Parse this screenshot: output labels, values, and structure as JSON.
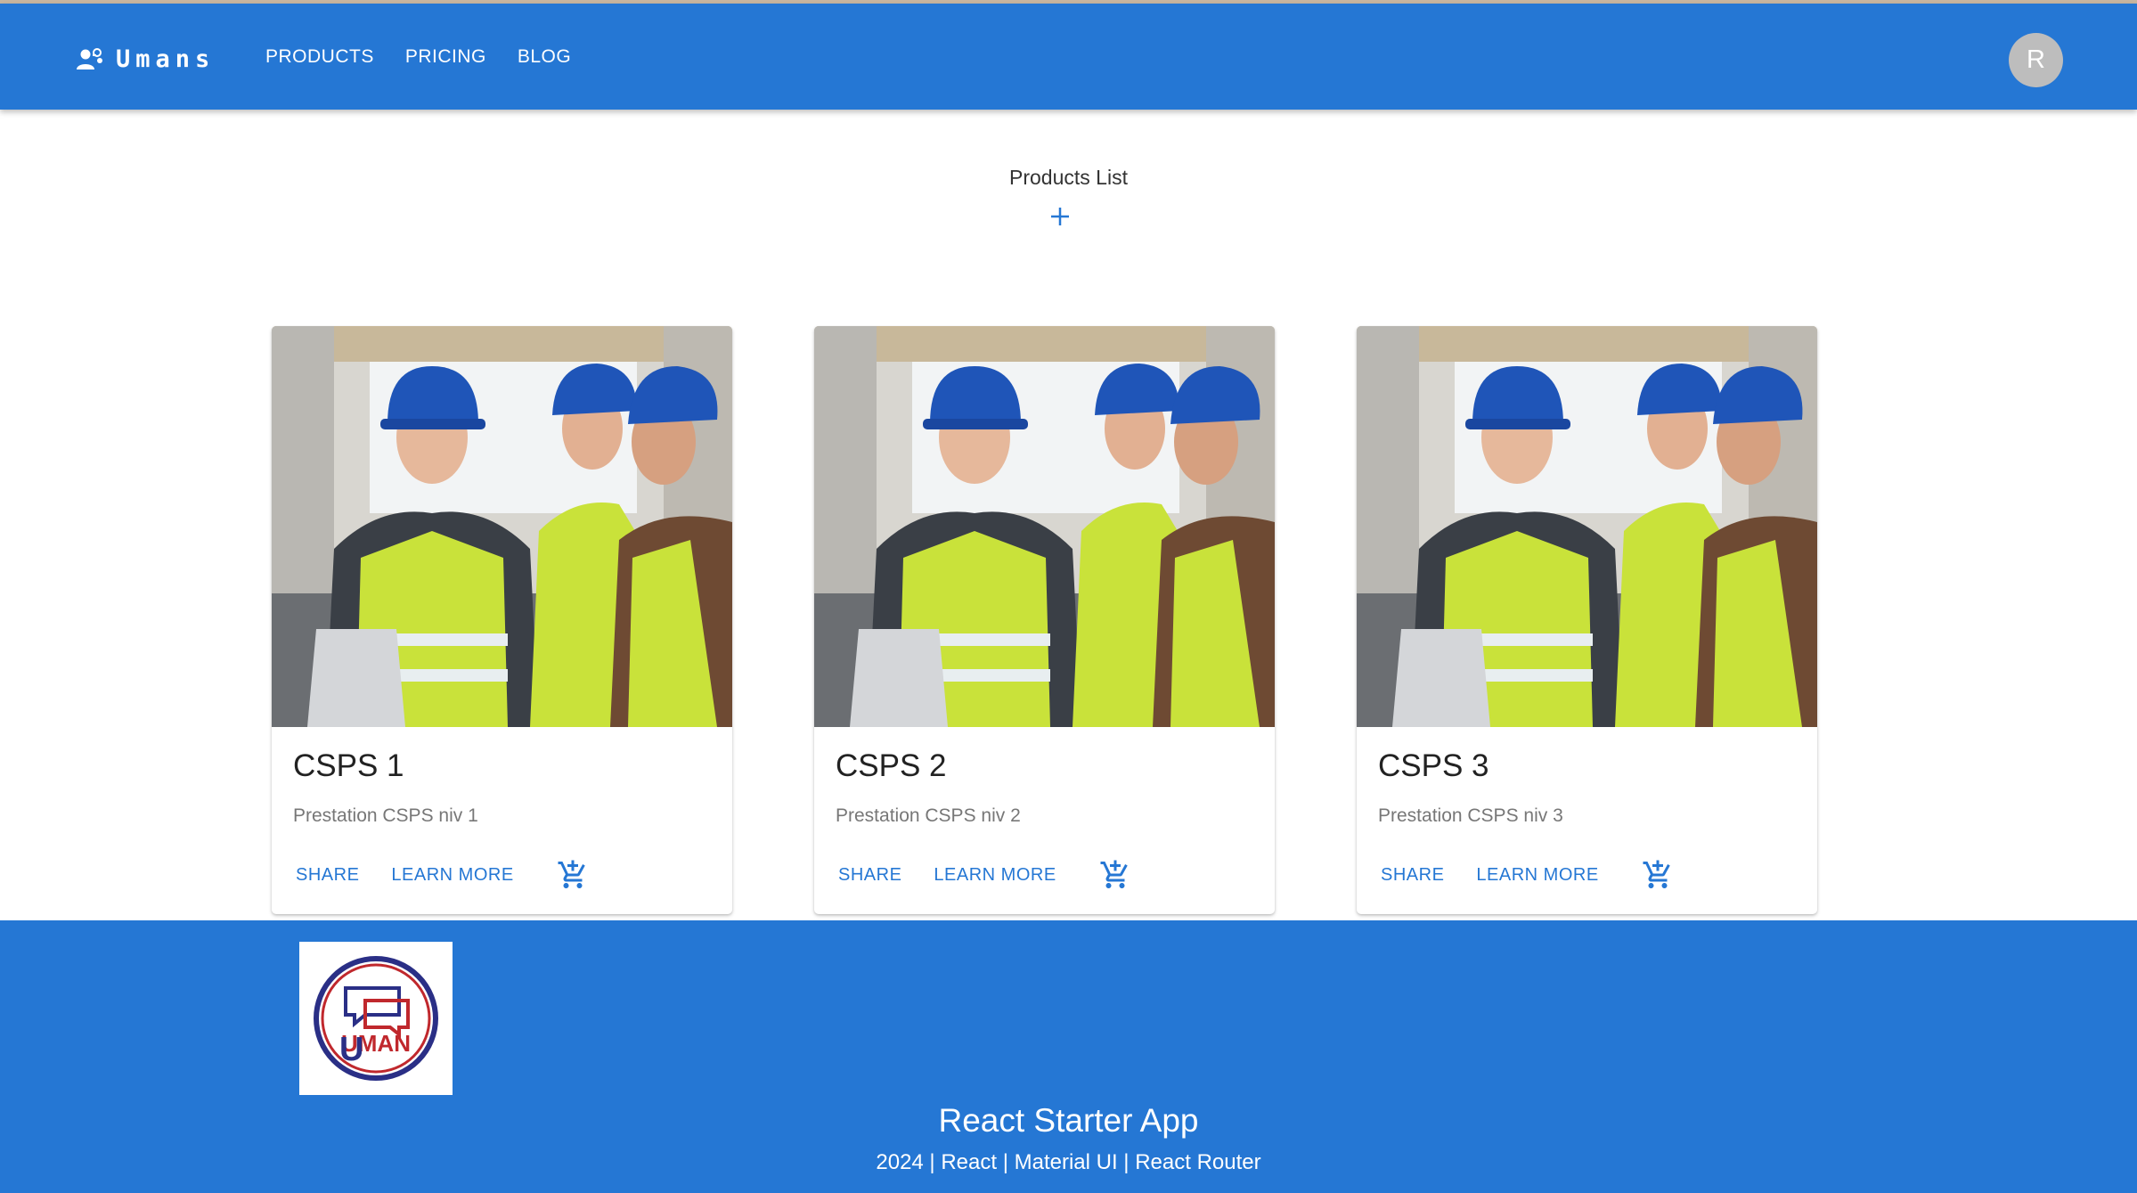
{
  "header": {
    "brand": "Umans",
    "nav": [
      "PRODUCTS",
      "PRICING",
      "BLOG"
    ],
    "avatar_initial": "R",
    "accent_color": "#2577d4"
  },
  "main": {
    "title": "Products List",
    "add_icon": "plus-icon"
  },
  "products": [
    {
      "title": "CSPS 1",
      "description": "Prestation CSPS niv 1",
      "share": "SHARE",
      "learn_more": "LEARN MORE",
      "cart_icon": "add-shopping-cart-icon"
    },
    {
      "title": "CSPS 2",
      "description": "Prestation CSPS niv 2",
      "share": "SHARE",
      "learn_more": "LEARN MORE",
      "cart_icon": "add-shopping-cart-icon"
    },
    {
      "title": "CSPS 3",
      "description": "Prestation CSPS niv 3",
      "share": "SHARE",
      "learn_more": "LEARN MORE",
      "cart_icon": "add-shopping-cart-icon"
    }
  ],
  "footer": {
    "logo_text": "UMAN",
    "title": "React Starter App",
    "subtitle": "2024 | React | Material UI | React Router"
  }
}
